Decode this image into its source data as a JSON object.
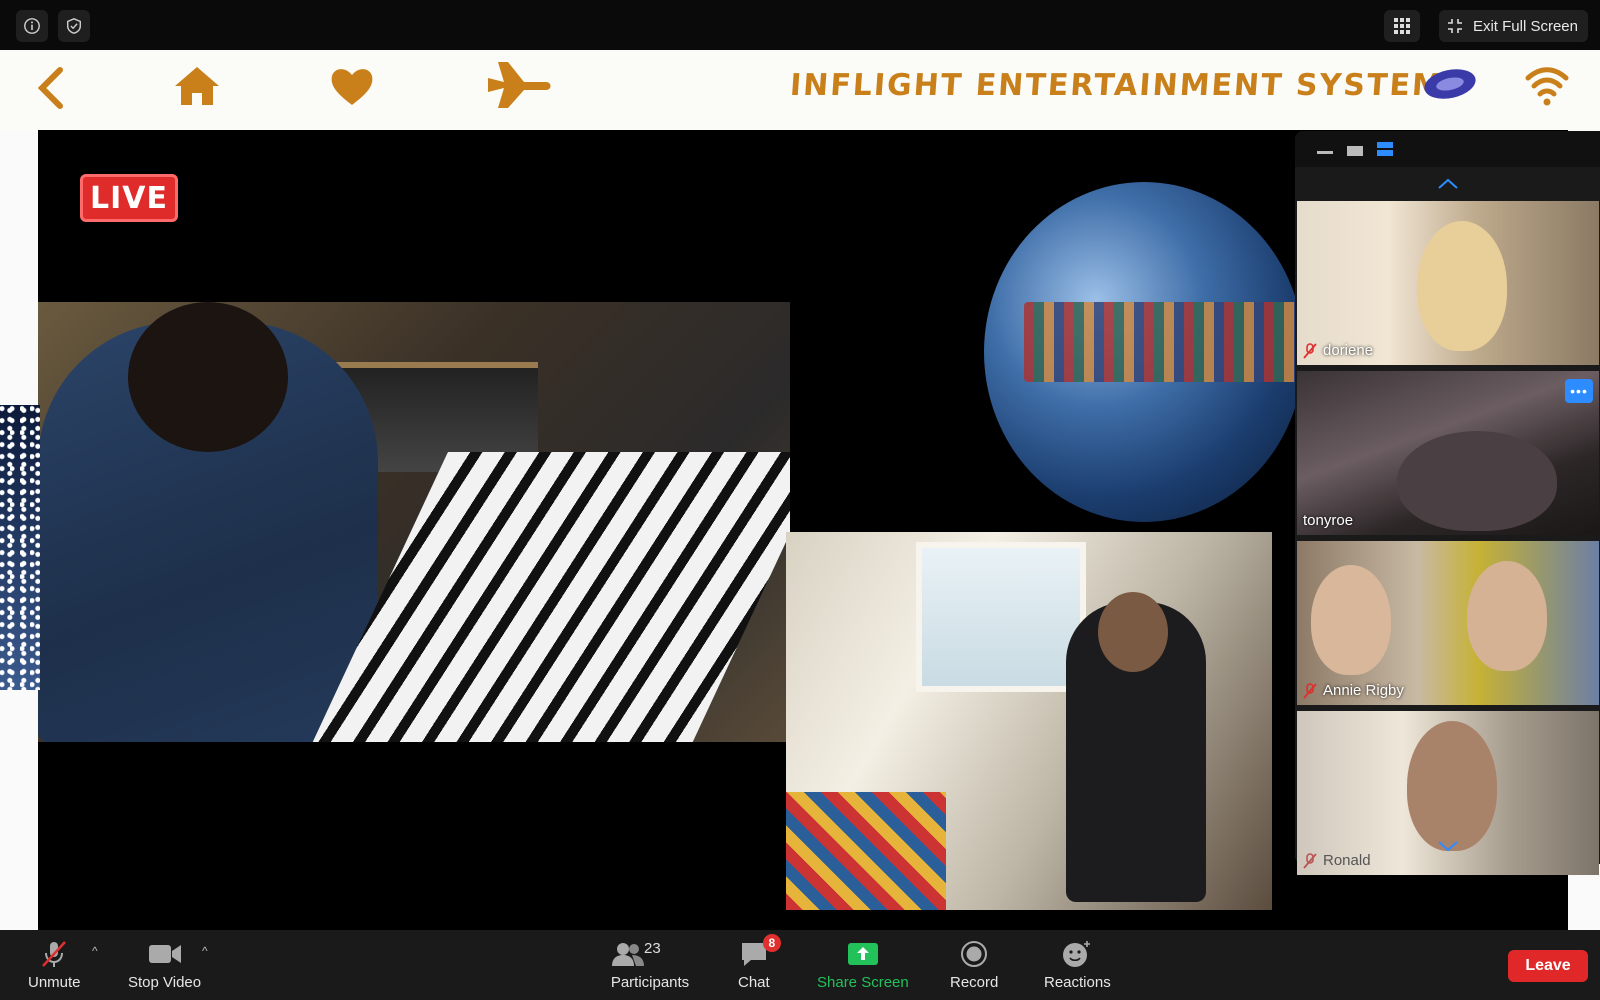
{
  "topbar": {
    "info_icon": "info-icon",
    "security_icon": "shield-check-icon",
    "gallery_view_icon": "grid-icon",
    "exit_fullscreen_label": "Exit Full Screen"
  },
  "shared_screen": {
    "nav_icons": [
      "back-chevron-icon",
      "home-icon",
      "heart-icon",
      "plane-icon",
      "logo",
      "wifi-icon"
    ],
    "title": "INFLIGHT ENTERTAINMENT SYSTEM",
    "live_badge": "LIVE"
  },
  "gallery": {
    "view_modes": [
      "minimize-view-icon",
      "single-view-icon",
      "gallery-strip-icon"
    ],
    "participants": [
      {
        "name": "doriene",
        "muted": true
      },
      {
        "name": "tonyroe",
        "muted": false,
        "has_more_button": true
      },
      {
        "name": "Annie Rigby",
        "muted": true
      },
      {
        "name": "Ronald",
        "muted": true
      }
    ],
    "more_label": "•••"
  },
  "toolbar": {
    "unmute_label": "Unmute",
    "stop_video_label": "Stop Video",
    "participants_label": "Participants",
    "participants_count": "23",
    "chat_label": "Chat",
    "chat_badge": "8",
    "share_screen_label": "Share Screen",
    "record_label": "Record",
    "reactions_label": "Reactions",
    "leave_label": "Leave"
  },
  "colors": {
    "accent_orange": "#c9801a",
    "share_green": "#23c15a",
    "leave_red": "#e02828",
    "zoom_blue": "#2d8cff"
  }
}
